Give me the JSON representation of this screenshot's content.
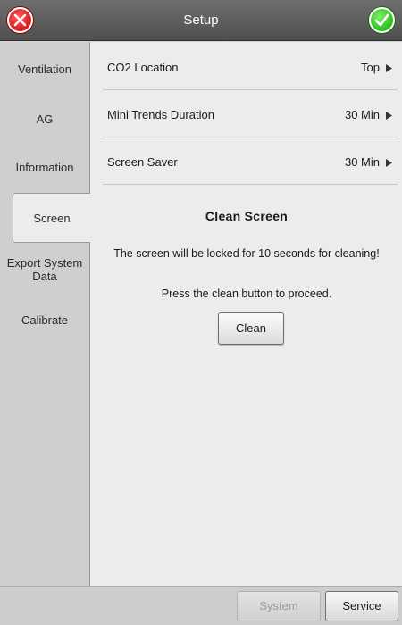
{
  "header": {
    "title": "Setup",
    "cancel_icon": "close-circle-icon",
    "confirm_icon": "check-circle-icon"
  },
  "sidebar": {
    "items": [
      {
        "label": "Ventilation"
      },
      {
        "label": "AG"
      },
      {
        "label": "Information"
      },
      {
        "label": "Screen"
      },
      {
        "label": "Export System Data"
      },
      {
        "label": "Calibrate"
      }
    ],
    "active": "Screen"
  },
  "settings": {
    "rows": [
      {
        "label": "CO2 Location",
        "value": "Top"
      },
      {
        "label": "Mini Trends Duration",
        "value": "30 Min"
      },
      {
        "label": "Screen Saver",
        "value": "30 Min"
      }
    ]
  },
  "clean_screen": {
    "title": "Clean Screen",
    "message": "The screen will be locked for 10 seconds for cleaning!",
    "instruction": "Press the clean button to proceed.",
    "button_label": "Clean"
  },
  "footer": {
    "system_label": "System",
    "service_label": "Service",
    "system_enabled": false
  },
  "colors": {
    "cancel": "#d91c1c",
    "confirm": "#2bbd1c",
    "titlebar": "#5a5a5a",
    "panel": "#ececec",
    "sidebar": "#cfcfcf"
  }
}
